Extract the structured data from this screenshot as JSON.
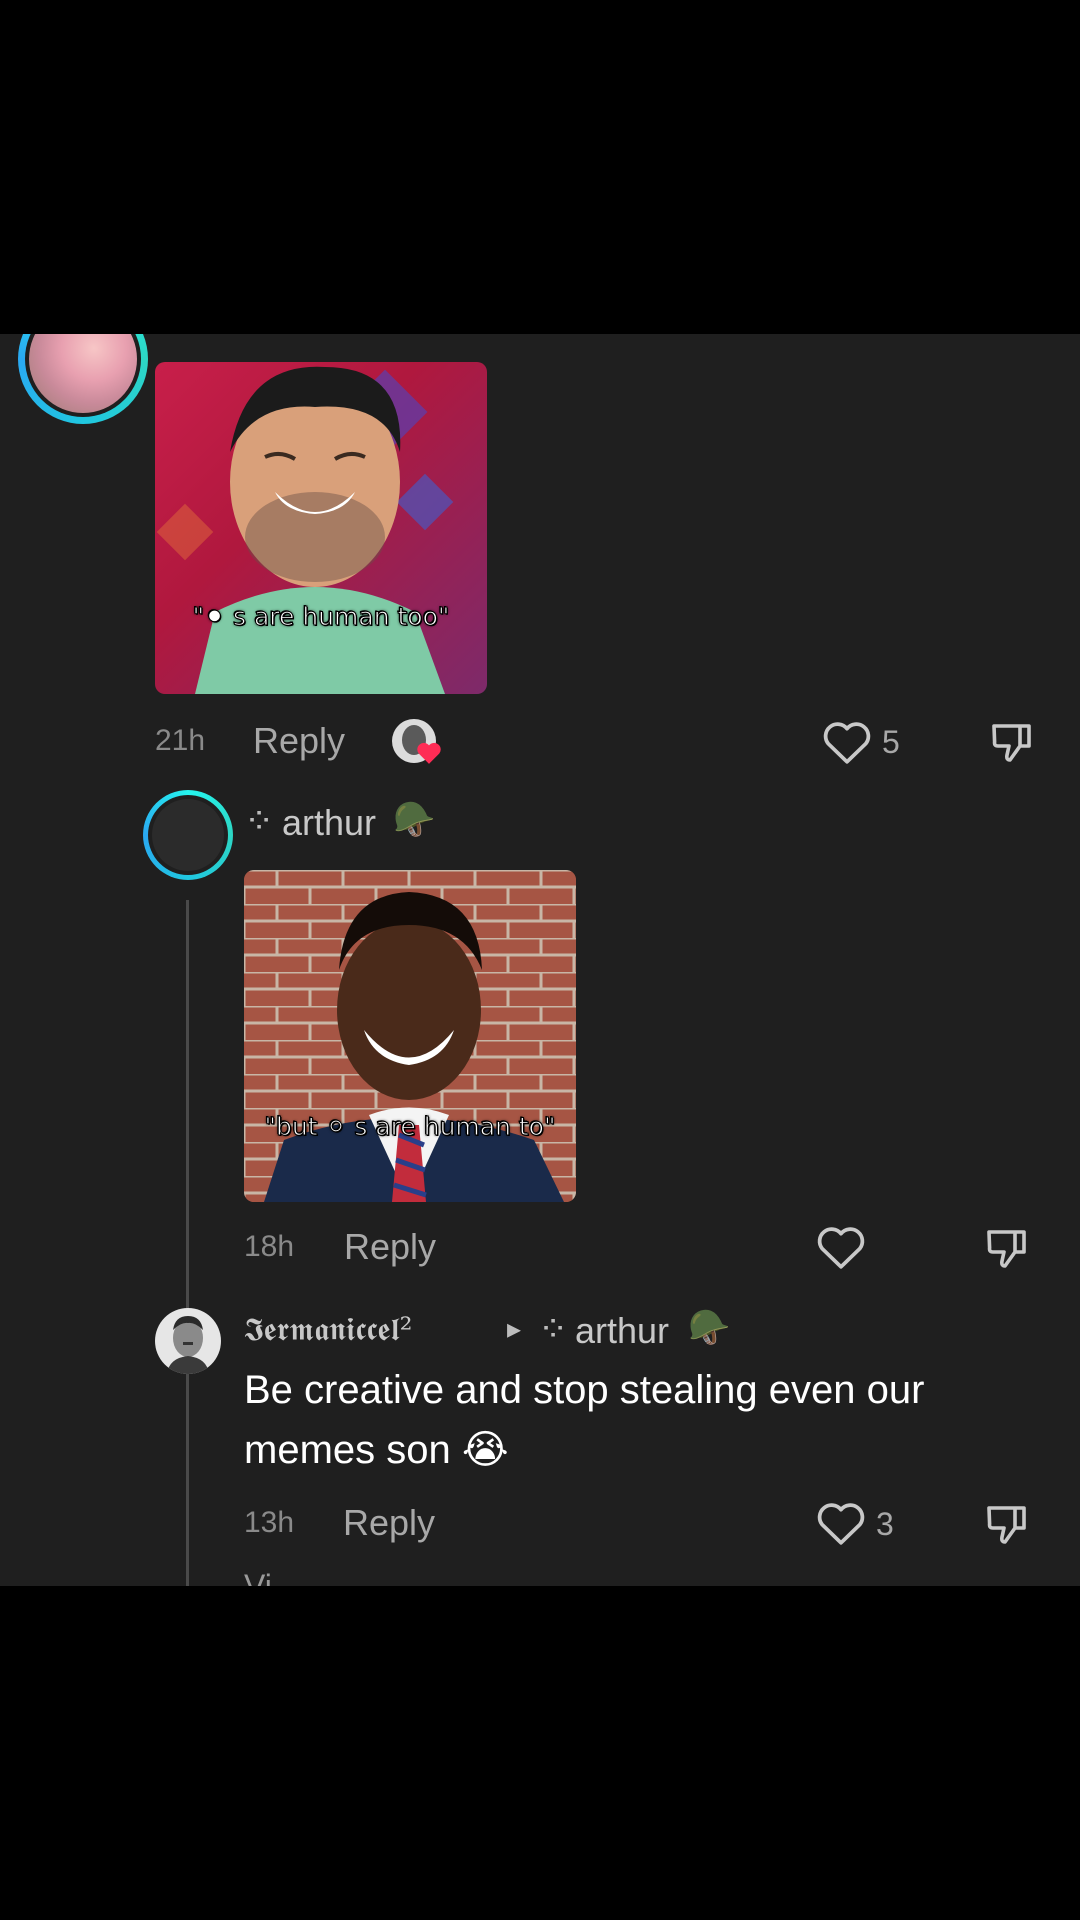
{
  "comments": [
    {
      "id": "parent",
      "meme_caption": "\"⚫ s are human too\"",
      "time": "21h",
      "reply_label": "Reply",
      "likes": "5",
      "creator_liked": true
    },
    {
      "id": "reply-arthur",
      "username": "arthur",
      "username_badge": "🪖",
      "username_prefix_glyph": "⁘",
      "meme_caption": "\"but ⚪ s are human to\"",
      "time": "18h",
      "reply_label": "Reply",
      "likes": ""
    },
    {
      "id": "reply-germaniccel",
      "username": "𝕴𝖊𝖗𝖒𝖆𝖓𝖎𝖈𝖈𝖊𝖑²",
      "reply_to_arrow": "▸",
      "reply_to_username": "arthur",
      "reply_to_badge": "🪖",
      "text": "Be creative and stop stealing even our memes son 😭",
      "time": "13h",
      "reply_label": "Reply",
      "likes": "3"
    }
  ],
  "partial_text": "Vi",
  "icons": {
    "like": "heart-outline-icon",
    "dislike": "thumbs-down-icon",
    "creator_like": "creator-liked-avatar-heart-icon"
  },
  "colors": {
    "panel_bg": "#1f1f1f",
    "meta_gray": "#8a8a8a",
    "ring_accent": "#25f4ee",
    "heart_red": "#fe2c55"
  }
}
